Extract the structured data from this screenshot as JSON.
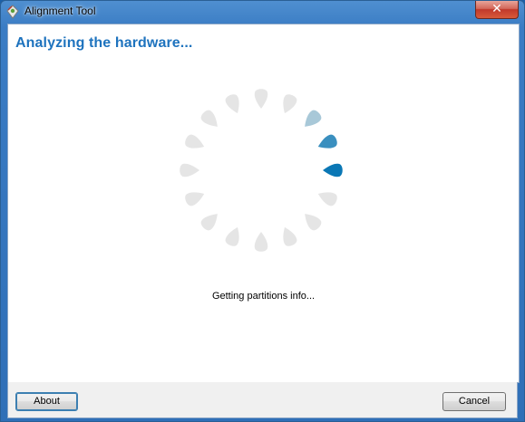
{
  "window": {
    "title": "Alignment Tool",
    "close_glyph": "✕"
  },
  "page": {
    "heading": "Analyzing the hardware...",
    "status": "Getting partitions info..."
  },
  "spinner": {
    "count": 16,
    "active_index": 4,
    "colors": {
      "inactive": "#e5e5e5",
      "trail1": "#a8c8d8",
      "trail2": "#3a8fbf",
      "active": "#0a77b5"
    }
  },
  "footer": {
    "about_label": "About",
    "cancel_label": "Cancel"
  }
}
